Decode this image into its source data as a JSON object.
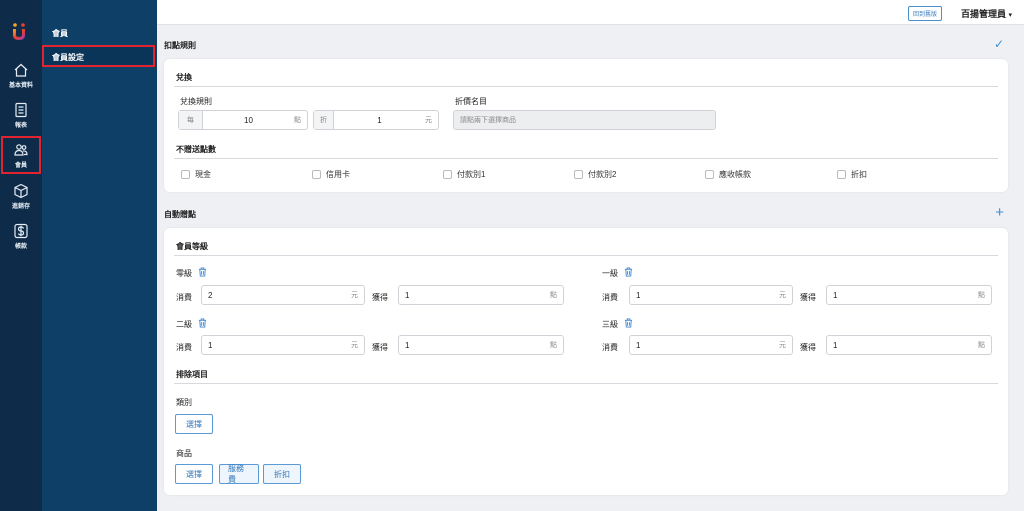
{
  "rail": {
    "items": [
      {
        "label": "基本資料"
      },
      {
        "label": "報表"
      },
      {
        "label": "會員"
      },
      {
        "label": "進銷存"
      },
      {
        "label": "帳款"
      }
    ]
  },
  "submenu": {
    "title": "會員",
    "item": "會員設定"
  },
  "topbar": {
    "old_link": "回到舊版",
    "user": "百揚管理員"
  },
  "points_rule": {
    "title": "扣點規則",
    "exchange": {
      "title": "兌換",
      "rule_label": "兌換規則",
      "per_prefix": "每",
      "per_value": "10",
      "per_suffix": "點",
      "off_prefix": "折",
      "off_value": "1",
      "off_suffix": "元",
      "discount_label": "折價名目",
      "discount_placeholder": "請點兩下選擇商品"
    },
    "no_points": {
      "title": "不贈送點數",
      "options": [
        "現金",
        "信用卡",
        "付款別1",
        "付款別2",
        "應收帳款",
        "折扣"
      ]
    }
  },
  "auto_points": {
    "title": "自動贈點",
    "level_title": "會員等級",
    "spend_label": "消費",
    "gain_label": "獲得",
    "yuan": "元",
    "point": "點",
    "levels": [
      {
        "name": "零級",
        "spend": "2",
        "gain": "1"
      },
      {
        "name": "一級",
        "spend": "1",
        "gain": "1"
      },
      {
        "name": "二級",
        "spend": "1",
        "gain": "1"
      },
      {
        "name": "三級",
        "spend": "1",
        "gain": "1"
      }
    ],
    "exclude_title": "排除項目",
    "category_label": "類別",
    "product_label": "商品",
    "select_btn": "選擇",
    "product_tags": [
      "服務費",
      "折扣"
    ]
  },
  "colors": {
    "rail": "#0e2c4a",
    "submenu": "#0e3f66",
    "accent": "#3f8fd8",
    "highlight": "#e1242f"
  }
}
